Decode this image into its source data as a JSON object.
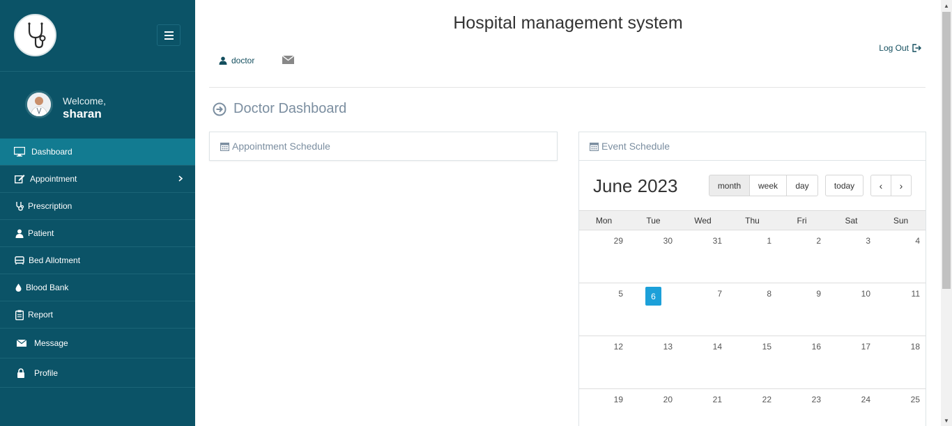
{
  "app": {
    "title": "Hospital management system"
  },
  "sidebar": {
    "welcome": "Welcome,",
    "username": "sharan",
    "items": [
      {
        "label": "Dashboard",
        "icon": "monitor-icon",
        "active": true
      },
      {
        "label": "Appointment",
        "icon": "edit-icon",
        "has_submenu": true
      },
      {
        "label": "Prescription",
        "icon": "stethoscope-icon"
      },
      {
        "label": "Patient",
        "icon": "user-icon"
      },
      {
        "label": "Bed Allotment",
        "icon": "bed-icon"
      },
      {
        "label": "Blood Bank",
        "icon": "drop-icon"
      },
      {
        "label": "Report",
        "icon": "clipboard-icon"
      },
      {
        "label": "Message",
        "icon": "envelope-icon"
      },
      {
        "label": "Profile",
        "icon": "lock-icon"
      }
    ]
  },
  "topbar": {
    "user_label": "doctor",
    "logout_label": "Log Out"
  },
  "page": {
    "title": "Doctor Dashboard"
  },
  "panels": {
    "appointment": {
      "title": "Appointment Schedule"
    },
    "event": {
      "title": "Event Schedule"
    }
  },
  "calendar": {
    "title": "June 2023",
    "view_buttons": [
      "month",
      "week",
      "day"
    ],
    "active_view": "month",
    "today_label": "today",
    "prev_label": "‹",
    "next_label": "›",
    "weekdays": [
      "Mon",
      "Tue",
      "Wed",
      "Thu",
      "Fri",
      "Sat",
      "Sun"
    ],
    "weeks": [
      [
        "29",
        "30",
        "31",
        "1",
        "2",
        "3",
        "4"
      ],
      [
        "5",
        "6",
        "7",
        "8",
        "9",
        "10",
        "11"
      ],
      [
        "12",
        "13",
        "14",
        "15",
        "16",
        "17",
        "18"
      ],
      [
        "19",
        "20",
        "21",
        "22",
        "23",
        "24",
        "25"
      ]
    ],
    "today": "6"
  },
  "colors": {
    "sidebar_bg": "#0b5367",
    "sidebar_active": "#127b91",
    "today_highlight": "#1ca0d9"
  }
}
